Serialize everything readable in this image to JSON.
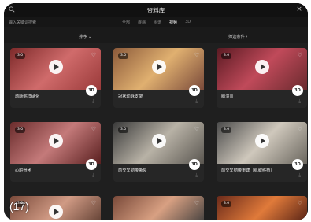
{
  "header": {
    "title": "资料库",
    "search_placeholder": "输入关键词搜索",
    "tabs": [
      {
        "label": "全部",
        "active": false
      },
      {
        "label": "疾病",
        "active": false
      },
      {
        "label": "图谱",
        "active": false
      },
      {
        "label": "视频",
        "active": true
      },
      {
        "label": "3D",
        "active": false
      }
    ]
  },
  "filters": {
    "sort_label": "排序",
    "filter_label": "筛选条件"
  },
  "cards": [
    {
      "label": "动脉粥样硬化",
      "badge": "3.0",
      "theme": "#b84a4a"
    },
    {
      "label": "冠状动脉支架",
      "badge": "3.0",
      "theme": "#b97e5a"
    },
    {
      "label": "脑溢血",
      "badge": "3.0",
      "theme": "#8f2f3a"
    },
    {
      "label": "心脏骨术",
      "badge": "3.0",
      "theme": "#7a3b3b"
    },
    {
      "label": "前交叉韧带撕裂",
      "badge": "3.0",
      "theme": "#7a6f64"
    },
    {
      "label": "前交叉韧带重建（肌腱移植）",
      "badge": "3.0",
      "theme": "#7f7b72"
    },
    {
      "label": "",
      "badge": "3.0",
      "theme": "#8a5a4a"
    },
    {
      "label": "",
      "badge": "",
      "theme": "#9b6a54"
    },
    {
      "label": "",
      "badge": "3.0",
      "theme": "#9a4a2a"
    }
  ],
  "overlay_text": "(17)",
  "icons": {
    "search": "search-icon",
    "close": "close-icon",
    "play": "play-icon",
    "heart": "heart-icon",
    "three_d": "3d-icon",
    "download": "download-icon"
  }
}
